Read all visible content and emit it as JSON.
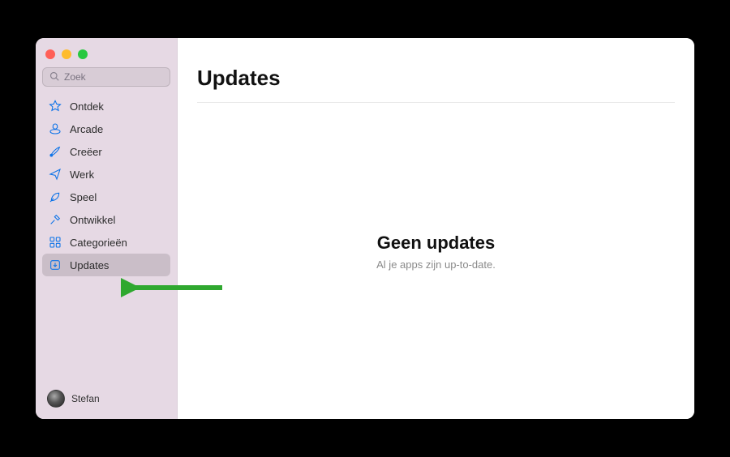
{
  "search": {
    "placeholder": "Zoek"
  },
  "sidebar": {
    "items": [
      {
        "label": "Ontdek"
      },
      {
        "label": "Arcade"
      },
      {
        "label": "Creëer"
      },
      {
        "label": "Werk"
      },
      {
        "label": "Speel"
      },
      {
        "label": "Ontwikkel"
      },
      {
        "label": "Categorieën"
      },
      {
        "label": "Updates"
      }
    ]
  },
  "user": {
    "name": "Stefan"
  },
  "main": {
    "title": "Updates",
    "empty_heading": "Geen updates",
    "empty_sub": "Al je apps zijn up-to-date."
  },
  "colors": {
    "accent": "#0a72e8",
    "sidebar_bg": "#e6d9e4",
    "arrow": "#2fa82f"
  }
}
